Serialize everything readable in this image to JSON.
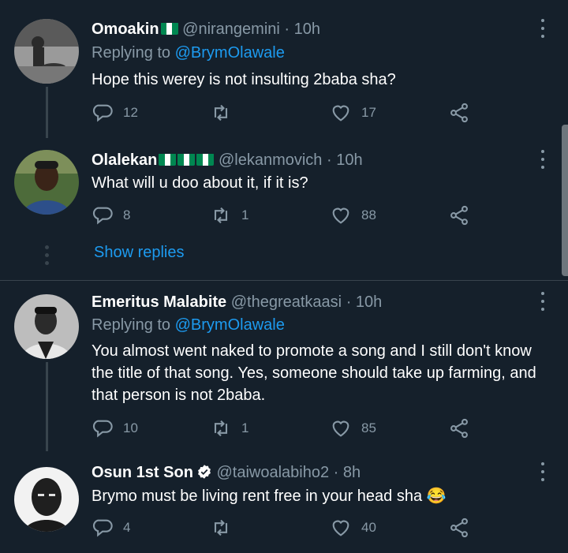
{
  "tweets": [
    {
      "name": "Omoakin",
      "flags": 1,
      "handle": "@nirangemini",
      "time": "10h",
      "replying_prefix": "Replying to",
      "replying_to": "@BrymOlawale",
      "text": "Hope this werey is not insulting 2baba sha?",
      "replies": "12",
      "retweets": "",
      "likes": "17"
    },
    {
      "name": "Olalekan",
      "flags": 3,
      "handle": "@lekanmovich",
      "time": "10h",
      "text": "What will u doo about it, if it is?",
      "replies": "8",
      "retweets": "1",
      "likes": "88"
    },
    {
      "name": "Emeritus Malabite",
      "handle": "@thegreatkaasi",
      "time": "10h",
      "replying_prefix": "Replying to",
      "replying_to": "@BrymOlawale",
      "text": "You almost went naked to promote a song and I still don't know the title of that song. Yes, someone should take up farming, and that person is not 2baba.",
      "replies": "10",
      "retweets": "1",
      "likes": "85"
    },
    {
      "name": "Osun 1st Son",
      "verified": true,
      "handle": "@taiwoalabiho2",
      "time": "8h",
      "text": "Brymo must be living rent free in your head sha 😂",
      "replies": "4",
      "retweets": "",
      "likes": "40"
    }
  ],
  "show_replies": "Show replies",
  "separator": "·",
  "colors": {
    "background": "#15202b",
    "link": "#1d9bf0",
    "muted": "#8899a6",
    "divider": "#38444d",
    "flag_green": "#008751",
    "verified": "#1d9bf0"
  }
}
